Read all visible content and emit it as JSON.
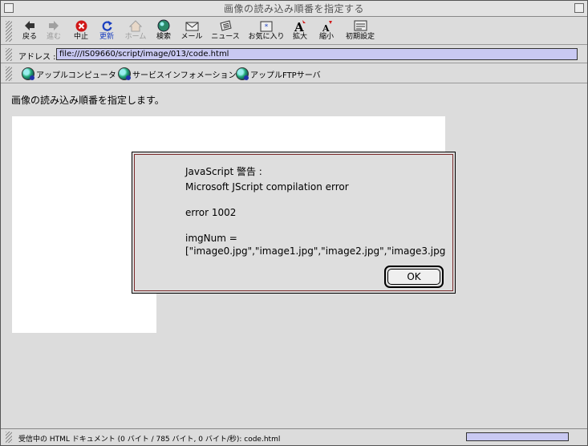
{
  "window": {
    "title": "画像の読み込み順番を指定する"
  },
  "toolbar": {
    "buttons": [
      {
        "label": "戻る",
        "icon": "back-arrow-icon"
      },
      {
        "label": "進む",
        "icon": "forward-arrow-icon"
      },
      {
        "label": "中止",
        "icon": "stop-icon"
      },
      {
        "label": "更新",
        "icon": "refresh-icon"
      },
      {
        "label": "ホーム",
        "icon": "home-icon"
      },
      {
        "label": "検索",
        "icon": "search-globe-icon"
      },
      {
        "label": "メール",
        "icon": "mail-icon"
      },
      {
        "label": "ニュース",
        "icon": "news-icon"
      },
      {
        "label": "お気に入り",
        "icon": "favorites-icon"
      },
      {
        "label": "拡大",
        "icon": "enlarge-text-icon"
      },
      {
        "label": "縮小",
        "icon": "shrink-text-icon"
      },
      {
        "label": "初期設定",
        "icon": "preferences-icon"
      }
    ]
  },
  "address": {
    "label": "アドレス :",
    "value": "file:///IS09660/script/image/013/code.html"
  },
  "favorites": [
    {
      "label": "アップルコンピュータ"
    },
    {
      "label": "サービスインフォメーション"
    },
    {
      "label": "アップルFTPサーバ"
    }
  ],
  "page": {
    "text": "画像の読み込み順番を指定します。"
  },
  "dialog": {
    "title": "JavaScript 警告 :",
    "line1": "Microsoft JScript compilation error",
    "line2": "error 1002",
    "line3": "imgNum =",
    "line4": "[\"image0.jpg\",\"image1.jpg\",\"image2.jpg\",\"image3.jpg",
    "ok_label": "OK"
  },
  "status": {
    "text": "受信中の HTML ドキュメント (0 バイト / 785 バイト, 0 バイト/秒): code.html"
  },
  "colors": {
    "accent": "#c9c9f2",
    "dialog_border": "#7a2a2a"
  }
}
